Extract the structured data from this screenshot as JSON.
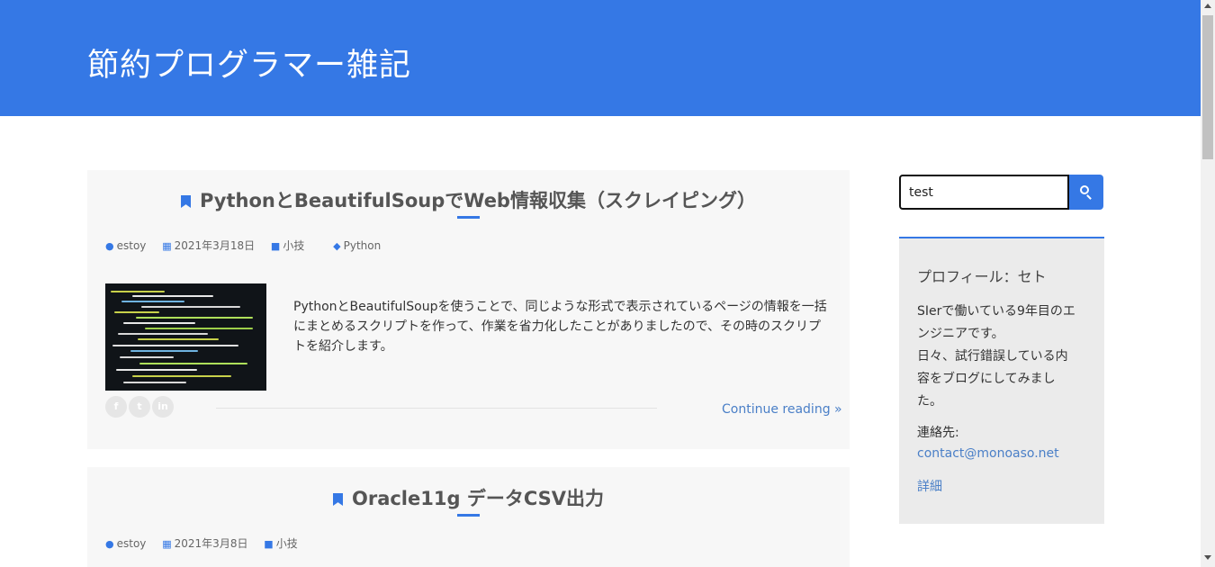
{
  "site": {
    "title": "節約プログラマー雑記"
  },
  "posts": [
    {
      "title": "PythonとBeautifulSoupでWeb情報収集（スクレイピング）",
      "author": "estoy",
      "date": "2021年3月18日",
      "category": "小技",
      "tag": "Python",
      "excerpt": "PythonとBeautifulSoupを使うことで、同じような形式で表示されているページの情報を一括にまとめるスクリプトを作って、作業を省力化したことがありましたので、その時のスクリプトを紹介します。",
      "continue_label": "Continue reading »"
    },
    {
      "title": "Oracle11g データCSV出力",
      "author": "estoy",
      "date": "2021年3月8日",
      "category": "小技"
    }
  ],
  "share": {
    "facebook": "f",
    "twitter": "t",
    "linkedin": "in"
  },
  "search": {
    "value": "test"
  },
  "profile": {
    "title": "プロフィール：セト",
    "bio_lines": [
      "SIerで働いている9年目のエ",
      "ンジニアです。",
      "日々、試行錯誤している内",
      "容をブログにしてみまし",
      "た。"
    ],
    "contact_label": "連絡先:",
    "contact_email": "contact@monoaso.net",
    "details_link": "詳細"
  },
  "icons": {
    "bookmark": "bookmark-icon",
    "author": "user-icon",
    "date": "calendar-icon",
    "category": "folder-icon",
    "tag": "tag-icon",
    "search": "search-icon"
  },
  "colors": {
    "accent": "#3578e5",
    "link": "#4a7fc7",
    "card": "#f7f7f7",
    "widget": "#ebebeb"
  }
}
